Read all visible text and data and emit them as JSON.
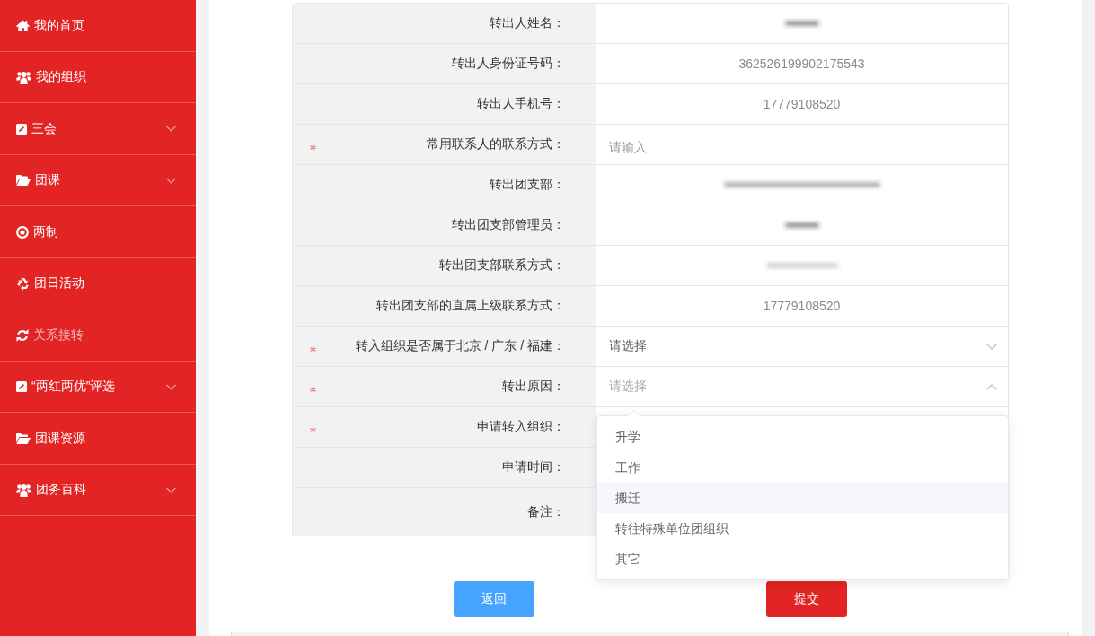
{
  "sidebar": {
    "items": [
      {
        "label": "我的首页",
        "expandable": false,
        "selected": false
      },
      {
        "label": "我的组织",
        "expandable": false,
        "selected": false
      },
      {
        "label": "三会",
        "expandable": true,
        "selected": false
      },
      {
        "label": "团课",
        "expandable": true,
        "selected": false
      },
      {
        "label": "两制",
        "expandable": false,
        "selected": false
      },
      {
        "label": "团日活动",
        "expandable": false,
        "selected": false
      },
      {
        "label": "关系接转",
        "expandable": false,
        "selected": true
      },
      {
        "label": "“两红两优”评选",
        "expandable": true,
        "selected": false
      },
      {
        "label": "团课资源",
        "expandable": false,
        "selected": false
      },
      {
        "label": "团务百科",
        "expandable": true,
        "selected": false
      }
    ]
  },
  "form": {
    "rows": [
      {
        "label": "转出人姓名：",
        "required": false,
        "kind": "blurredname"
      },
      {
        "label": "转出人身份证号码：",
        "required": false,
        "kind": "text",
        "value": "362526199902175543"
      },
      {
        "label": "转出人手机号：",
        "required": false,
        "kind": "text",
        "value": "17779108520"
      },
      {
        "label": "常用联系人的联系方式：",
        "required": true,
        "kind": "input",
        "placeholder": "请输入"
      },
      {
        "label": "转出团支部：",
        "required": false,
        "kind": "blurredorg"
      },
      {
        "label": "转出团支部管理员：",
        "required": false,
        "kind": "blurredname"
      },
      {
        "label": "转出团支部联系方式：",
        "required": false,
        "kind": "blurredphone"
      },
      {
        "label": "转出团支部的直属上级联系方式：",
        "required": false,
        "kind": "text",
        "value": "17779108520"
      },
      {
        "label": "转入组织是否属于北京 / 广东 / 福建：",
        "required": true,
        "kind": "select",
        "placeholder": "请选择",
        "expanded": false
      },
      {
        "label": "转出原因：",
        "required": true,
        "kind": "select",
        "placeholder": "请选择",
        "expanded": true,
        "options": [
          {
            "label": "升学",
            "highlighted": false
          },
          {
            "label": "工作",
            "highlighted": false
          },
          {
            "label": "搬迁",
            "highlighted": true
          },
          {
            "label": "转往特殊单位团组织",
            "highlighted": false
          },
          {
            "label": "其它",
            "highlighted": false
          }
        ]
      },
      {
        "label": "申请转入组织：",
        "required": true,
        "kind": "covered"
      },
      {
        "label": "申请时间：",
        "required": false,
        "kind": "covered"
      },
      {
        "label": "备注：",
        "required": false,
        "kind": "textarea"
      }
    ]
  },
  "buttons": [
    {
      "label": "返回",
      "kind": "primary"
    },
    {
      "label": "提交",
      "kind": "danger"
    }
  ]
}
